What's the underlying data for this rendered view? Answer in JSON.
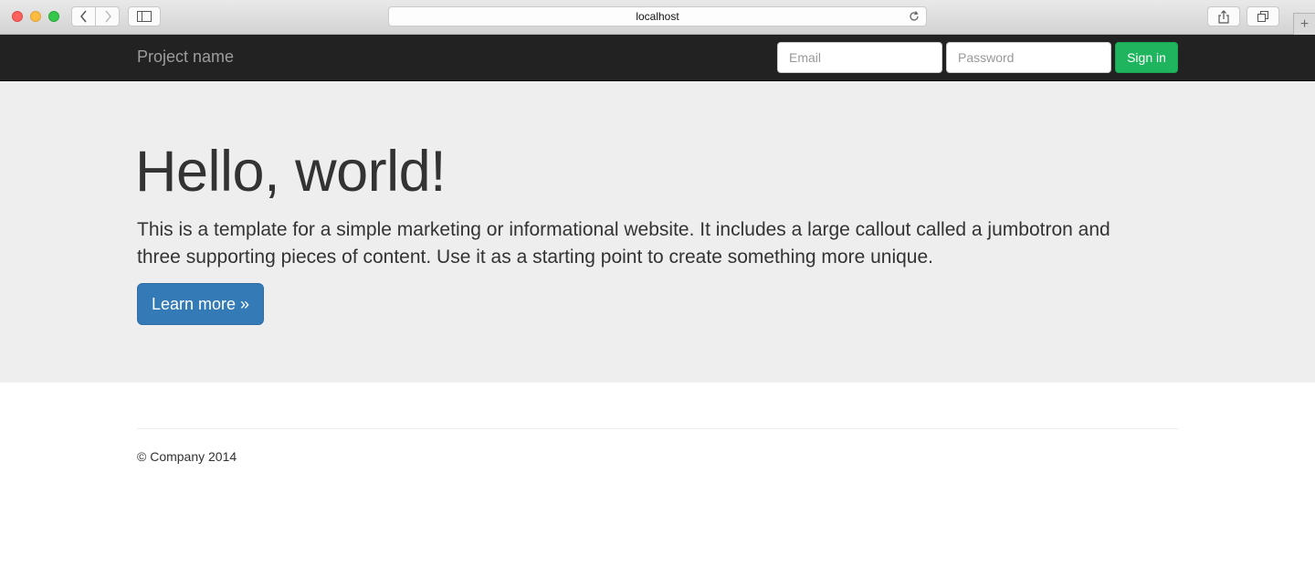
{
  "browser": {
    "url": "localhost",
    "icons": {
      "back": "chevron-left-icon",
      "forward": "chevron-right-icon",
      "sidebar": "sidebar-icon",
      "reload": "reload-icon",
      "share": "share-icon",
      "tabs": "tabs-icon",
      "new_tab": "plus-icon"
    },
    "new_tab_glyph": "+"
  },
  "navbar": {
    "brand": "Project name",
    "email_placeholder": "Email",
    "password_placeholder": "Password",
    "signin_label": "Sign in",
    "colors": {
      "background": "#222222",
      "signin": "#1fb55f"
    }
  },
  "jumbotron": {
    "title": "Hello, world!",
    "text": "This is a template for a simple marketing or informational website. It includes a large callout called a jumbotron and three supporting pieces of content. Use it as a starting point to create something more unique.",
    "button_label": "Learn more »",
    "colors": {
      "background": "#eeeeee",
      "button": "#337ab7"
    }
  },
  "footer": {
    "text": "© Company 2014"
  }
}
